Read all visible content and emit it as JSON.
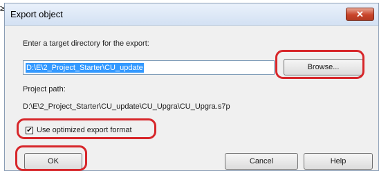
{
  "dialog": {
    "title": "Export object",
    "close_glyph": "✕",
    "directory_prompt": "Enter a target directory for the export:",
    "directory_value": "D:\\E\\2_Project_Starter\\CU_update",
    "browse_label": "Browse...",
    "project_path_label": "Project path:",
    "project_path_value": "D:\\E\\2_Project_Starter\\CU_update\\CU_Upgra\\CU_Upgra.s7p",
    "optimized_checkbox": {
      "label": "Use optimized export format",
      "checked": true,
      "glyph": "✔"
    },
    "ok_label": "OK",
    "cancel_label": "Cancel",
    "help_label": "Help"
  },
  "annotation_color": "#d7262a",
  "cursor_glyph": "≥"
}
